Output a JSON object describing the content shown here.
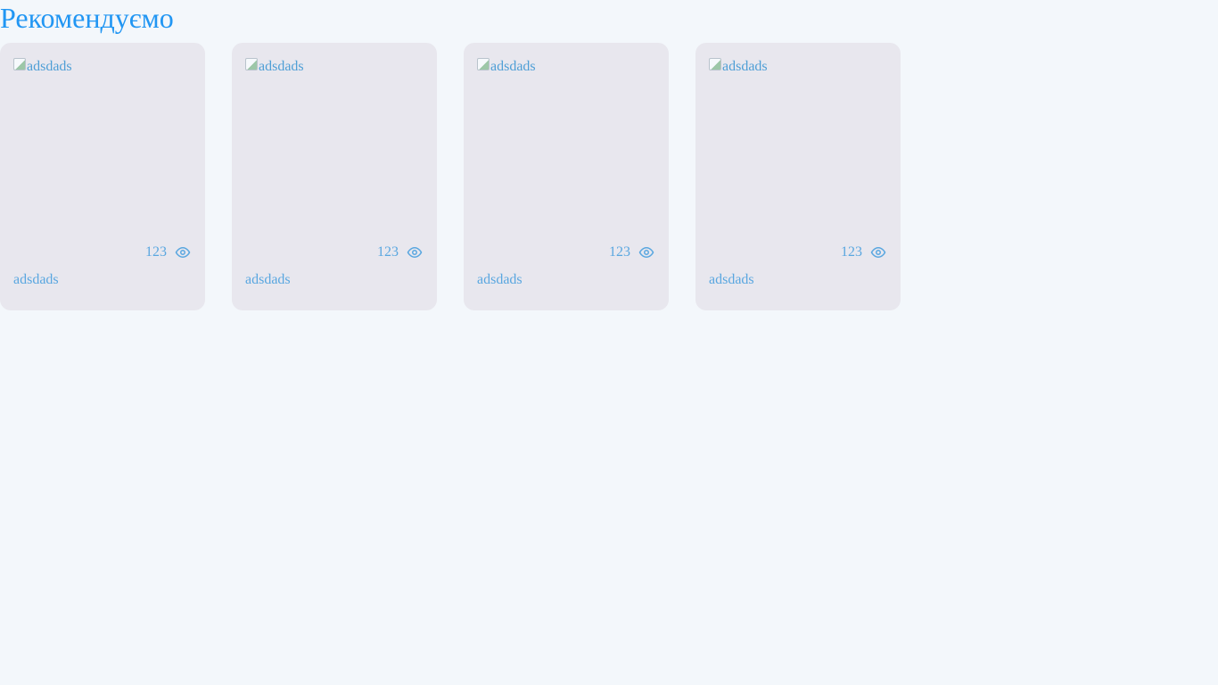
{
  "section": {
    "title": "Рекомендуємо"
  },
  "cards": [
    {
      "image_alt": "adsdads",
      "views": "123",
      "title": "adsdads",
      "icon": "eye-icon"
    },
    {
      "image_alt": "adsdads",
      "views": "123",
      "title": "adsdads",
      "icon": "eye-icon"
    },
    {
      "image_alt": "adsdads",
      "views": "123",
      "title": "adsdads",
      "icon": "eye-icon"
    },
    {
      "image_alt": "adsdads",
      "views": "123",
      "title": "adsdads",
      "icon": "eye-icon"
    }
  ],
  "colors": {
    "accent": "#2196f3",
    "card_text": "#5aa7e0",
    "card_background": "#e8e7ee",
    "page_background": "#f3f7fb"
  }
}
